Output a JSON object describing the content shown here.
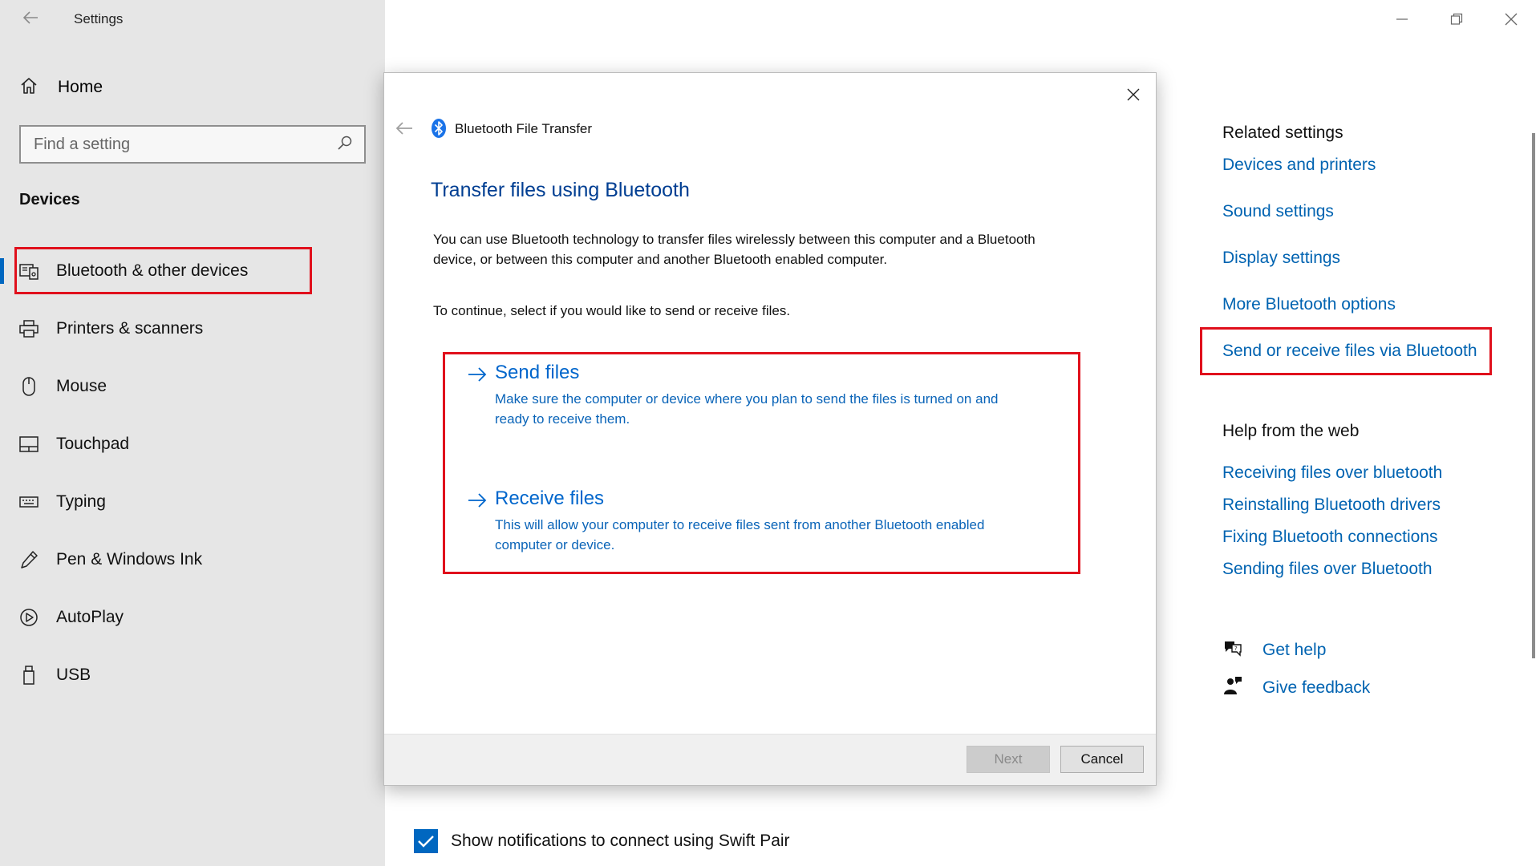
{
  "window": {
    "title": "Settings",
    "controls": [
      "minimize-icon",
      "restore-icon",
      "close-icon"
    ]
  },
  "sidebar": {
    "home_label": "Home",
    "search_placeholder": "Find a setting",
    "section": "Devices",
    "items": [
      {
        "label": "Bluetooth & other devices",
        "icon": "bluetooth-devices-icon",
        "selected": true
      },
      {
        "label": "Printers & scanners",
        "icon": "printer-icon"
      },
      {
        "label": "Mouse",
        "icon": "mouse-icon"
      },
      {
        "label": "Touchpad",
        "icon": "touchpad-icon"
      },
      {
        "label": "Typing",
        "icon": "keyboard-icon"
      },
      {
        "label": "Pen & Windows Ink",
        "icon": "pen-icon"
      },
      {
        "label": "AutoPlay",
        "icon": "autoplay-icon"
      },
      {
        "label": "USB",
        "icon": "usb-icon"
      }
    ]
  },
  "main": {
    "swift_pair_label": "Show notifications to connect using Swift Pair",
    "swift_pair_checked": true
  },
  "related": {
    "heading": "Related settings",
    "links": [
      "Devices and printers",
      "Sound settings",
      "Display settings",
      "More Bluetooth options",
      "Send or receive files via Bluetooth"
    ],
    "web_heading": "Help from the web",
    "web_links": [
      "Receiving files over bluetooth",
      "Reinstalling Bluetooth drivers",
      "Fixing Bluetooth connections",
      "Sending files over Bluetooth"
    ],
    "get_help": "Get help",
    "give_feedback": "Give feedback"
  },
  "dialog": {
    "title": "Bluetooth File Transfer",
    "heading": "Transfer files using Bluetooth",
    "description": "You can use Bluetooth technology to transfer files wirelessly between this computer and a Bluetooth device, or between this computer and another Bluetooth enabled computer.",
    "prompt": "To continue, select if you would like to send or receive files.",
    "send": {
      "title": "Send files",
      "description": "Make sure the computer or device where you plan to send the files is turned on and ready to receive them."
    },
    "receive": {
      "title": "Receive files",
      "description": "This will allow your computer to receive files sent from another Bluetooth enabled computer or device."
    },
    "next_label": "Next",
    "cancel_label": "Cancel"
  },
  "colors": {
    "accent": "#0067c0",
    "link": "#0063b1",
    "highlight": "#e0101c",
    "sidebar_bg": "#e6e6e6"
  }
}
